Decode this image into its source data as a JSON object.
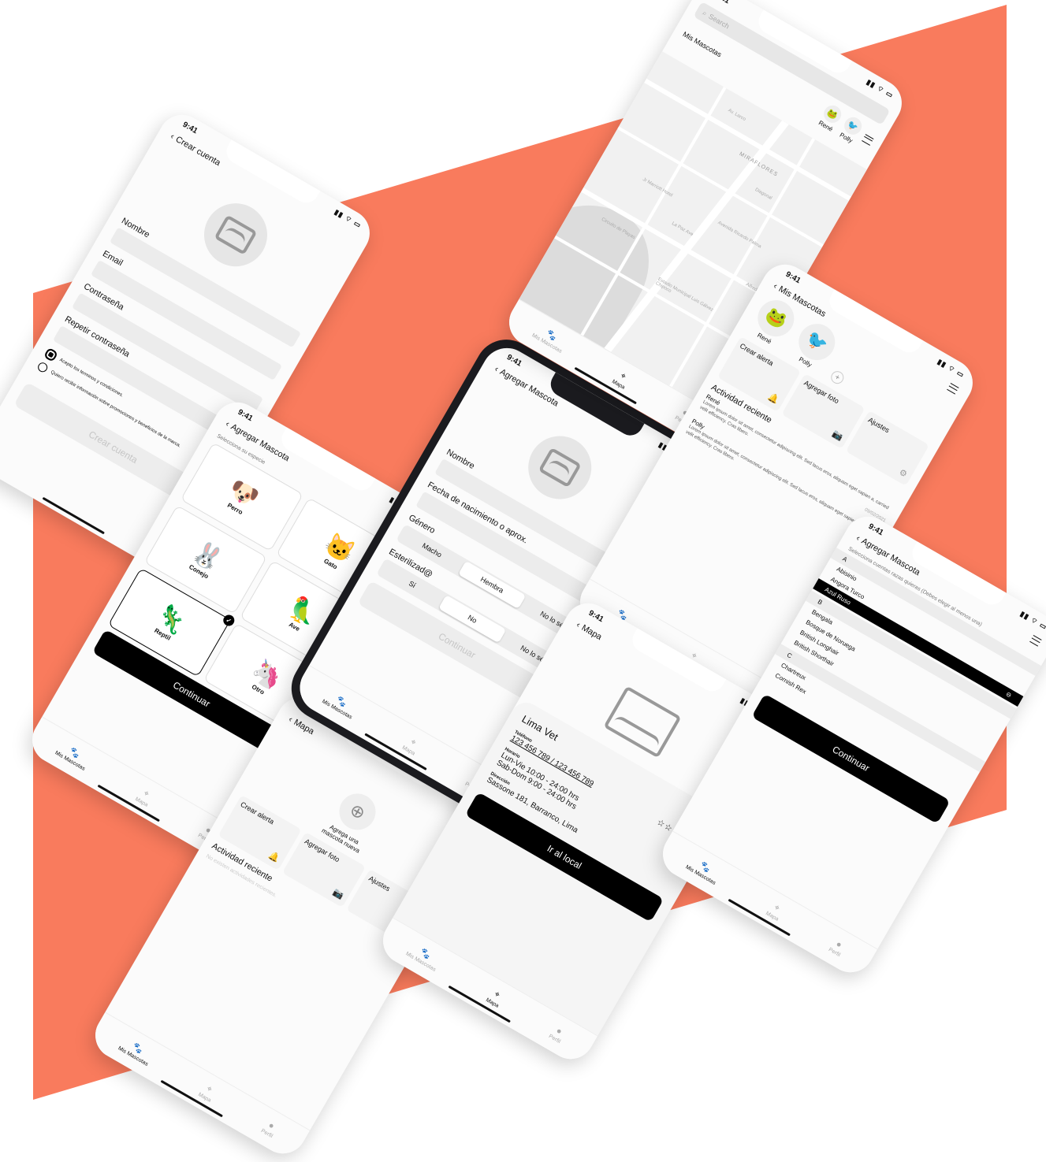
{
  "colors": {
    "accent": "#f97b5d",
    "dark": "#111111",
    "field": "#ececec"
  },
  "time": "9:41",
  "tabs": {
    "home": "Mis Mascotas",
    "map": "Mapa",
    "profile": "Perfil"
  },
  "crear_cuenta": {
    "title": "Crear cuenta",
    "fields": [
      "Nombre",
      "Email",
      "Contraseña",
      "Repetir contraseña"
    ],
    "terms": "Acepto los terminos y condiciones.",
    "promo": "Quiero recibir información sobre promociones y beneficios de la marca.",
    "button": "Crear cuenta"
  },
  "especie": {
    "title": "Agregar Mascota",
    "subtitle": "Selecciona su especie",
    "items": [
      {
        "name": "Perro",
        "icon": "🐶"
      },
      {
        "name": "Gato",
        "icon": "🐱"
      },
      {
        "name": "Conejo",
        "icon": "🐰"
      },
      {
        "name": "Ave",
        "icon": "🦜"
      },
      {
        "name": "Reptil",
        "icon": "🦎"
      },
      {
        "name": "Otro",
        "icon": "🦄"
      }
    ],
    "button": "Continuar"
  },
  "agregar": {
    "title": "Agregar Mascota",
    "nombre": "Nombre",
    "fecha": "Fecha de nacimiento o aprox.",
    "genero": "Género",
    "genero_opts": [
      "Macho",
      "Hembra",
      "No lo sé"
    ],
    "esterilizado": "Esterilizad@",
    "ester_opts": [
      "Sí",
      "No",
      "No lo sé"
    ],
    "button": "Continuar"
  },
  "mapa_list": {
    "title": "Mapa",
    "add_pet": "Agrega una mascota nueva",
    "crear_alerta": "Crear alerta",
    "agregar_foto": "Agregar foto",
    "ajustes": "Ajustes",
    "actividad": "Actividad reciente",
    "empty": "No existen actividades recientes."
  },
  "map_screen": {
    "search": "Search",
    "mis_mascotas": "Mis Mascotas",
    "pets": [
      "René",
      "Polly"
    ],
    "streets": [
      "MIRAFLORES",
      "Av. Larco",
      "Diagonal",
      "Jr Marriott Hotel",
      "La Paz Ave",
      "Avenida Ricardo Palma",
      "Circuito de Playas",
      "Estadio Municipal Luis Gálvez Chipoco",
      "Alfredo B."
    ]
  },
  "mis_mascotas": {
    "title": "Mis Mascotas",
    "pets": [
      "René",
      "Polly"
    ],
    "crear_alerta": "Crear alerta",
    "agregar_foto": "Agregar foto",
    "ajustes": "Ajustes",
    "actividad": "Actividad reciente",
    "items": [
      {
        "pet": "René",
        "text": "Lorem ipsum dolor sit amet, consectetur adipiscing elit. Sed lacus eros, aliquam eget sapien a, carried velit efficiency. Cras libero.",
        "date": "09/02/2021"
      },
      {
        "pet": "Polly",
        "text": "Lorem ipsum dolor sit amet, consectetur adipiscing elit. Sed lacus eros, aliquam eget sapien a, carried velit efficiency. Cras libero.",
        "date": "09/02/2021"
      }
    ]
  },
  "vet": {
    "title": "Mapa",
    "name": "Lima Vet",
    "rating": 0,
    "telefono_label": "Teléfono",
    "telefono": "123 456 789 / 123 456 789",
    "horario_label": "Horario",
    "horario1": "Lun-Vie 10:00 - 24:00 hrs",
    "horario2": "Sab-Dom 9:00 - 24:00 hrs",
    "direccion_label": "Dirección",
    "direccion": "Sassone 181, Barranco, Lima",
    "button": "Ir al local"
  },
  "razas": {
    "title": "Agregar Mascota",
    "subtitle": "Selecciona cuentas razas quieras (Debes elegir al menos una)",
    "groups": [
      {
        "letter": "A",
        "items": [
          "Abisinio",
          "Angora Turco",
          "Azul Ruso"
        ]
      },
      {
        "letter": "B",
        "items": [
          "Bengala",
          "Bosque de Noruega",
          "British Longhair",
          "British Shorthair"
        ]
      },
      {
        "letter": "C",
        "items": [
          "Chartreux",
          "Cornish Rex"
        ]
      }
    ],
    "selected": "Azul Ruso",
    "button": "Continuar"
  }
}
